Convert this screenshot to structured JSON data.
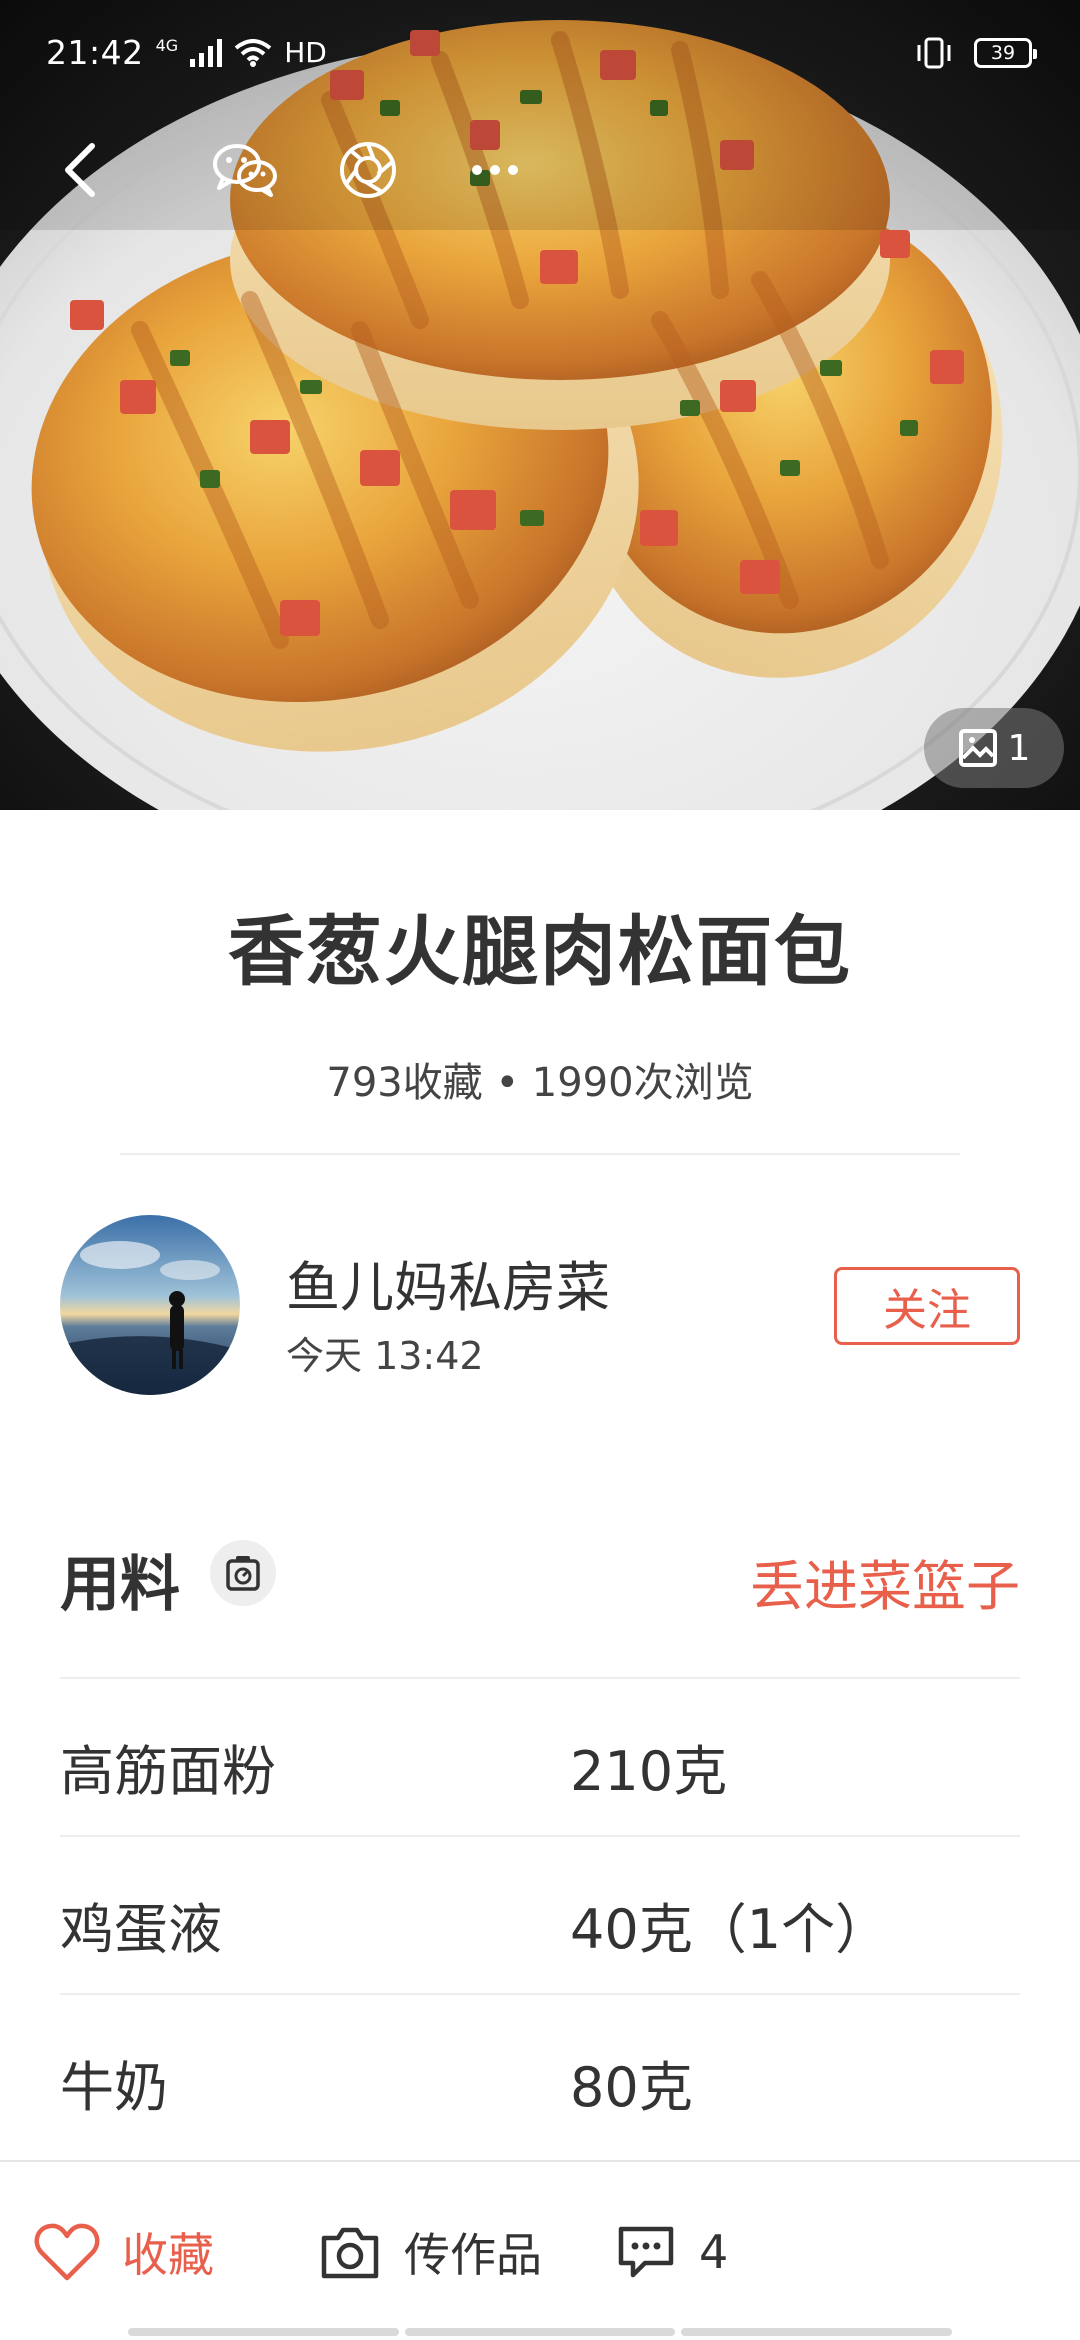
{
  "status_bar": {
    "time": "21:42",
    "network": "4G",
    "hd": "HD",
    "battery": "39",
    "icons": [
      "signal-icon",
      "wifi-icon",
      "vibrate-icon",
      "battery-icon"
    ]
  },
  "nav": {
    "icons": [
      "back-icon",
      "wechat-icon",
      "moments-icon",
      "more-icon"
    ]
  },
  "photo": {
    "image_count": "1",
    "icon": "image-icon"
  },
  "recipe": {
    "title": "香葱火腿肉松面包",
    "stats": "793收藏 • 1990次浏览"
  },
  "author": {
    "name": "鱼儿妈私房菜",
    "time": "今天 13:42",
    "follow_label": "关注"
  },
  "ingredients": {
    "title": "用料",
    "basket_label": "丢进菜篮子",
    "scale_icon": "kitchen-scale-icon",
    "items": [
      {
        "name": "高筋面粉",
        "amount": "210克"
      },
      {
        "name": "鸡蛋液",
        "amount": "40克（1个）"
      },
      {
        "name": "牛奶",
        "amount": "80克"
      }
    ]
  },
  "bottom_bar": {
    "favorite_label": "收藏",
    "upload_label": "传作品",
    "comment_count": "4",
    "icons": [
      "heart-icon",
      "camera-icon",
      "comment-icon"
    ]
  },
  "colors": {
    "accent": "#e8604c",
    "text": "#333333",
    "divider": "#eeeeee"
  }
}
